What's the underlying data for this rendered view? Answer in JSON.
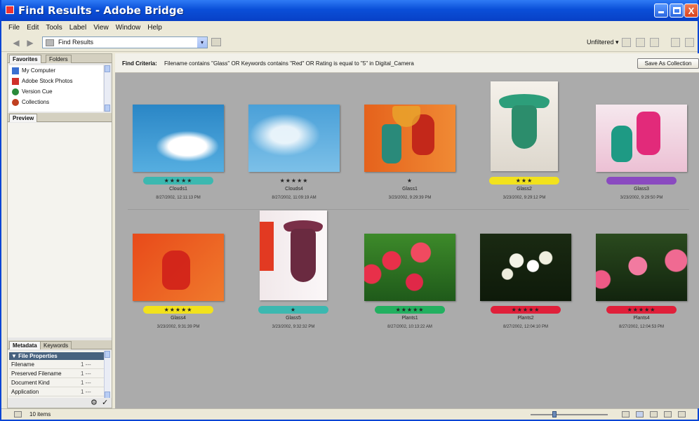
{
  "window": {
    "title": "Find Results - Adobe Bridge",
    "close_glyph": "X"
  },
  "menu": [
    "File",
    "Edit",
    "Tools",
    "Label",
    "View",
    "Window",
    "Help"
  ],
  "toolbar": {
    "path": "Find Results",
    "filter": "Unfiltered ▾",
    "back_glyph": "◀",
    "forward_glyph": "▶",
    "dropdown_glyph": "▾"
  },
  "left_panel": {
    "tabs_top": [
      "Favorites",
      "Folders"
    ],
    "favorites": [
      {
        "label": "My Computer",
        "icon": "computer-icon",
        "color": "#3a6fd0"
      },
      {
        "label": "Adobe Stock Photos",
        "icon": "stock-photos-icon",
        "color": "#d0302a"
      },
      {
        "label": "Version Cue",
        "icon": "version-cue-icon",
        "color": "#2a8a3a"
      },
      {
        "label": "Collections",
        "icon": "collections-icon",
        "color": "#c04020"
      }
    ],
    "preview_tab": "Preview",
    "tabs_bottom": [
      "Metadata",
      "Keywords"
    ],
    "metadata_header": "▼ File Properties",
    "metadata_rows": [
      {
        "label": "Filename",
        "value": "1 ---"
      },
      {
        "label": "Preserved Filename",
        "value": "1 ---"
      },
      {
        "label": "Document Kind",
        "value": "1 ---"
      },
      {
        "label": "Application",
        "value": "1 ---"
      }
    ],
    "footer_icons": [
      "⚙",
      "✓"
    ]
  },
  "criteria": {
    "label": "Find Criteria:",
    "text": "Filename contains \"Glass\" OR Keywords contains \"Red\" OR Rating is equal to \"5\" in Digital_Camera",
    "button": "Save As Collection"
  },
  "thumbnails": [
    {
      "name": "Clouds1",
      "date": "8/27/2002, 12:11:13 PM",
      "stars": "★★★★★",
      "label_color": "#3cb8b0",
      "img": "clouds1-image"
    },
    {
      "name": "Clouds4",
      "date": "8/27/2002, 11:09:19 AM",
      "stars": "★★★★★",
      "label_color": "",
      "img": "clouds4-image"
    },
    {
      "name": "Glass1",
      "date": "3/23/2002, 9:29:39 PM",
      "stars": "★",
      "label_color": "",
      "img": "glass1-image"
    },
    {
      "name": "Glass2",
      "date": "3/23/2002, 9:29:12 PM",
      "stars": "★★★",
      "label_color": "#f2e21c",
      "img": "glass2-image"
    },
    {
      "name": "Glass3",
      "date": "3/23/2002, 9:29:50 PM",
      "stars": "",
      "label_color": "#8a4ac0",
      "img": "glass3-image"
    },
    {
      "name": "Glass4",
      "date": "3/23/2002, 9:31:39 PM",
      "stars": "★★★★★",
      "label_color": "#f2e21c",
      "img": "glass4-image"
    },
    {
      "name": "Glass5",
      "date": "3/23/2002, 9:32:32 PM",
      "stars": "★",
      "label_color": "#3cb8b0",
      "img": "glass5-image"
    },
    {
      "name": "Plants1",
      "date": "8/27/2002, 10:13:22 AM",
      "stars": "★★★★★",
      "label_color": "#22b060",
      "img": "plants1-image"
    },
    {
      "name": "Plants2",
      "date": "8/27/2002, 12:04:10 PM",
      "stars": "★★★★★",
      "label_color": "#e0203a",
      "img": "plants2-image"
    },
    {
      "name": "Plants4",
      "date": "8/27/2002, 12:04:53 PM",
      "stars": "★★★★★",
      "label_color": "#e0203a",
      "img": "plants4-image"
    }
  ],
  "status": {
    "items": "10 items"
  }
}
